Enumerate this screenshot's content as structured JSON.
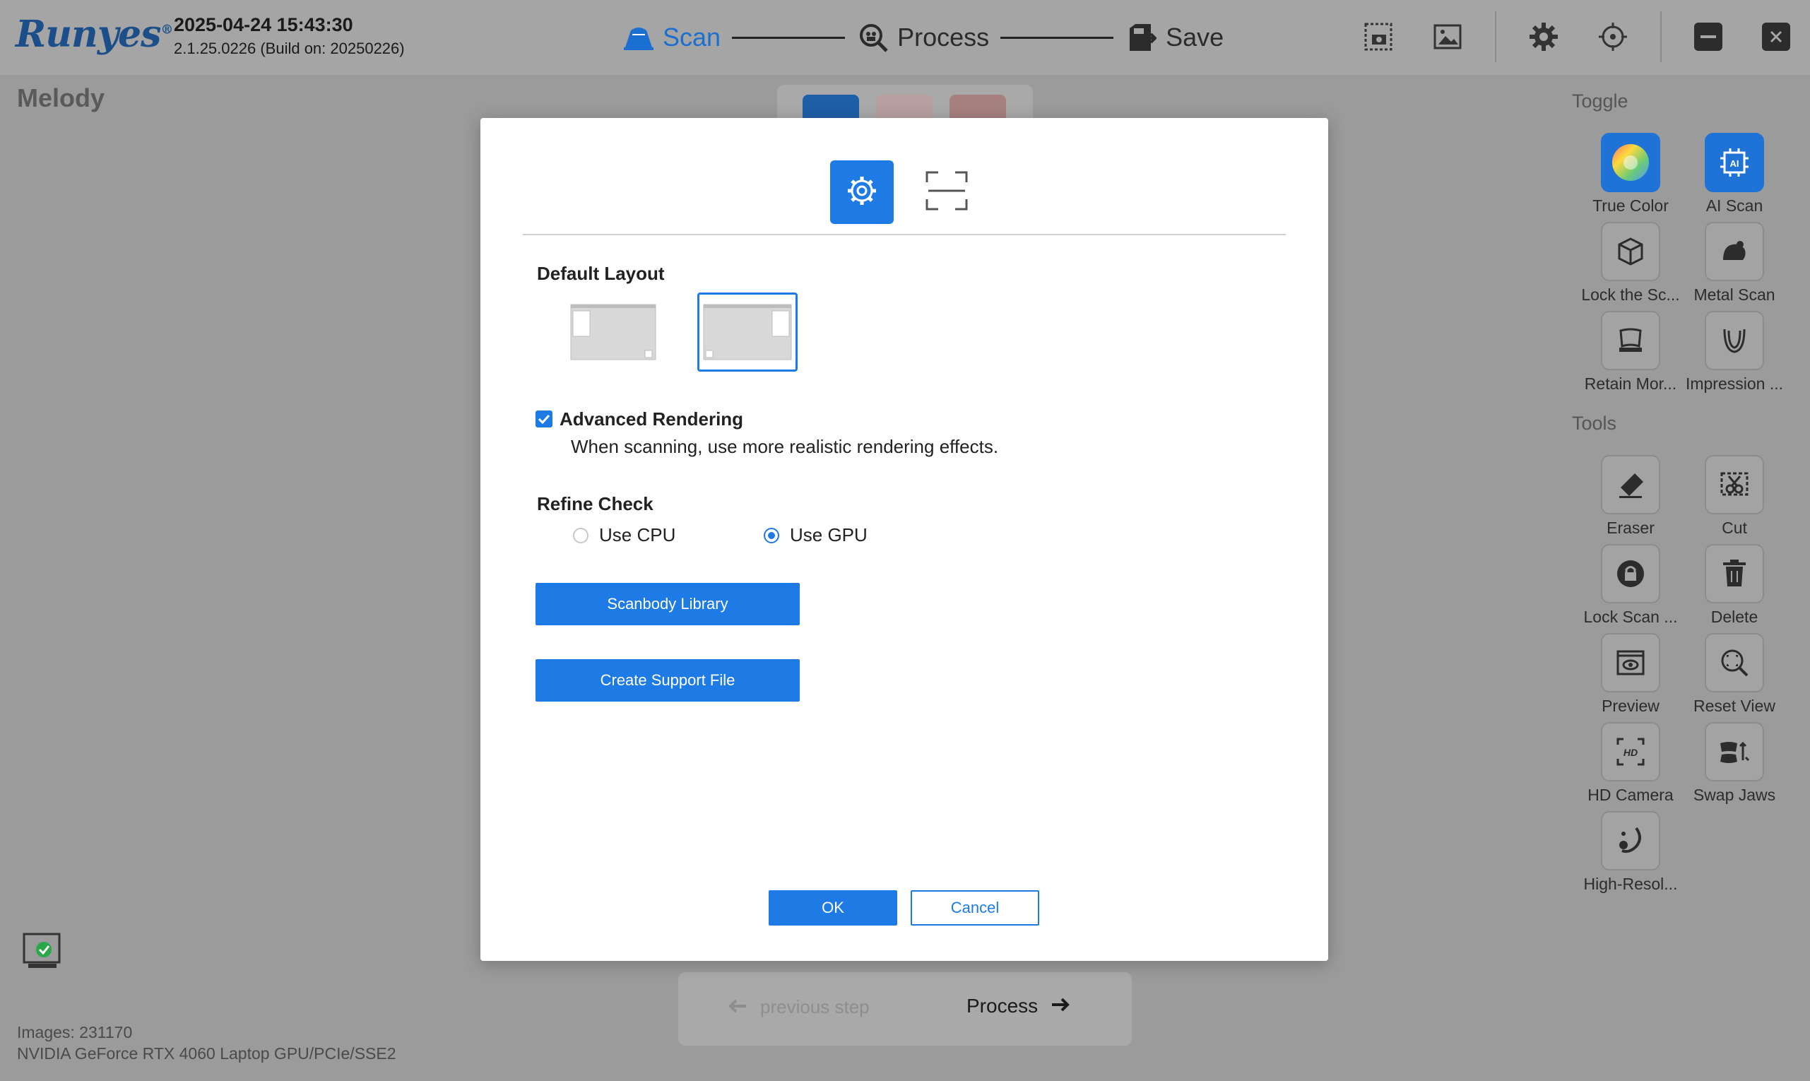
{
  "header": {
    "brand": "Runyes",
    "brand_mark": "®",
    "datetime": "2025-04-24 15:43:30",
    "version": "2.1.25.0226 (Build on: 20250226)",
    "steps": [
      {
        "label": "Scan",
        "icon": "scanner-icon"
      },
      {
        "label": "Process",
        "icon": "magnifier-icon"
      },
      {
        "label": "Save",
        "icon": "save-icon"
      }
    ],
    "active_step": "Scan",
    "toolbar_icons": [
      "screenshot-icon",
      "gallery-icon",
      "settings-icon",
      "calibrate-icon",
      "minimize-icon",
      "close-icon"
    ]
  },
  "patient": {
    "name": "Melody"
  },
  "footer": {
    "images": "Images: 231170",
    "gpu": "NVIDIA GeForce RTX 4060 Laptop GPU/PCIe/SSE2"
  },
  "bottom_nav": {
    "prev": "previous step",
    "next": "Process"
  },
  "right_panel": {
    "toggle_title": "Toggle",
    "toggles": [
      {
        "label": "True Color",
        "icon": "color-wheel-icon",
        "active": true
      },
      {
        "label": "AI Scan",
        "icon": "ai-chip-icon",
        "active": true
      },
      {
        "label": "Lock the Sc...",
        "icon": "cube-icon",
        "active": false
      },
      {
        "label": "Metal Scan",
        "icon": "metal-icon",
        "active": false
      },
      {
        "label": "Retain Mor...",
        "icon": "tooth-retain-icon",
        "active": false
      },
      {
        "label": "Impression ...",
        "icon": "impression-icon",
        "active": false
      }
    ],
    "tools_title": "Tools",
    "tools": [
      {
        "label": "Eraser",
        "icon": "eraser-icon"
      },
      {
        "label": "Cut",
        "icon": "cut-icon"
      },
      {
        "label": "Lock Scan ...",
        "icon": "lock-icon"
      },
      {
        "label": "Delete",
        "icon": "trash-icon"
      },
      {
        "label": "Preview",
        "icon": "preview-icon"
      },
      {
        "label": "Reset View",
        "icon": "reset-view-icon"
      },
      {
        "label": "HD Camera",
        "icon": "hd-camera-icon"
      },
      {
        "label": "Swap Jaws",
        "icon": "swap-jaws-icon"
      },
      {
        "label": "High-Resol...",
        "icon": "high-res-icon"
      }
    ]
  },
  "dialog": {
    "tabs": [
      {
        "icon": "gear-icon",
        "active": true
      },
      {
        "icon": "fullscreen-icon",
        "active": false
      }
    ],
    "default_layout_label": "Default Layout",
    "layout_selected": 1,
    "advanced_rendering": {
      "label": "Advanced Rendering",
      "checked": true,
      "description": "When scanning, use more realistic rendering effects."
    },
    "refine_check": {
      "label": "Refine Check",
      "options": [
        "Use CPU",
        "Use GPU"
      ],
      "selected": "Use GPU"
    },
    "scanbody_library_label": "Scanbody Library",
    "create_support_file_label": "Create Support File",
    "ok_label": "OK",
    "cancel_label": "Cancel"
  },
  "colors": {
    "accent": "#1e7be6",
    "overlay": "#9b9b9b",
    "brand": "#1c4f8a"
  }
}
